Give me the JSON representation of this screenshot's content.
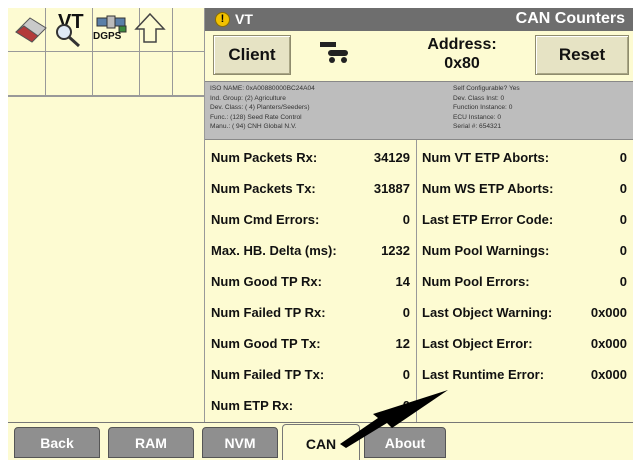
{
  "title_bar": {
    "vt_label": "VT",
    "title": "CAN Counters"
  },
  "icons": {
    "dgps_label": "DGPS",
    "vt_label": "VT"
  },
  "header": {
    "client_label": "Client",
    "address_label": "Address:",
    "address_value": "0x80",
    "reset_label": "Reset"
  },
  "info": {
    "left": [
      "ISO NAME: 0xA00880000BC24A04",
      "Ind. Group: (2) Agriculture",
      "Dev. Class: ( 4) Planters/Seeders)",
      "Func.: (128) Seed Rate Control",
      "Manu.: ( 94) CNH Global N.V."
    ],
    "right": [
      "Self Configurable? Yes",
      "Dev. Class Inst: 0",
      "Function Instance: 0",
      "ECU Instance: 0",
      "Serial #: 654321"
    ]
  },
  "counters_left": [
    {
      "label": "Num Packets Rx:",
      "value": "34129"
    },
    {
      "label": "Num Packets Tx:",
      "value": "31887"
    },
    {
      "label": "Num Cmd Errors:",
      "value": "0"
    },
    {
      "label": "Max. HB. Delta (ms):",
      "value": "1232"
    },
    {
      "label": "Num Good TP Rx:",
      "value": "14"
    },
    {
      "label": "Num Failed TP Rx:",
      "value": "0"
    },
    {
      "label": "Num Good TP Tx:",
      "value": "12"
    },
    {
      "label": "Num Failed TP Tx:",
      "value": "0"
    },
    {
      "label": "Num ETP Rx:",
      "value": "0"
    }
  ],
  "counters_right": [
    {
      "label": "Num VT ETP Aborts:",
      "value": "0"
    },
    {
      "label": "Num WS ETP Aborts:",
      "value": "0"
    },
    {
      "label": "Last ETP Error Code:",
      "value": "0"
    },
    {
      "label": "Num Pool Warnings:",
      "value": "0"
    },
    {
      "label": "Num Pool Errors:",
      "value": "0"
    },
    {
      "label": "Last Object Warning:",
      "value": "0x000"
    },
    {
      "label": "Last Object Error:",
      "value": "0x000"
    },
    {
      "label": "Last Runtime Error:",
      "value": "0x000"
    }
  ],
  "tabs": [
    {
      "label": "Back"
    },
    {
      "label": "RAM"
    },
    {
      "label": "NVM"
    },
    {
      "label": "CAN",
      "active": true
    },
    {
      "label": "About"
    }
  ],
  "colors": {
    "panel": "#fdfbd2",
    "titlebar": "#6e6e6e",
    "tab": "#8f8f8f",
    "info": "#bdbdbd"
  }
}
